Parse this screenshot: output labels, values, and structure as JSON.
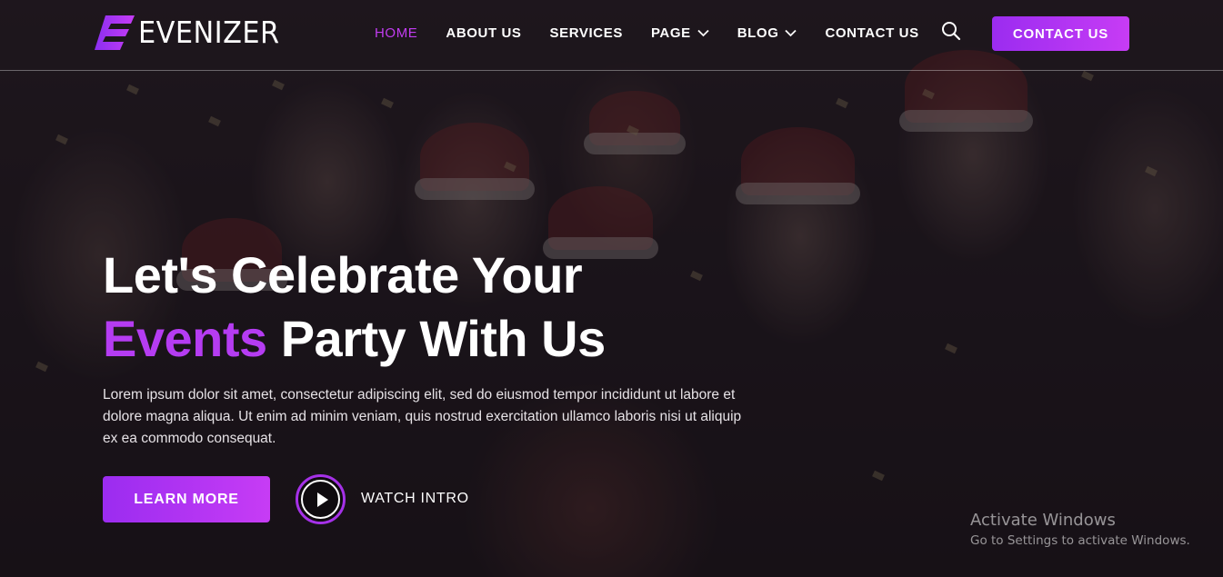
{
  "brand": {
    "name": "EVENIZER",
    "accent_color": "#b53cf2"
  },
  "nav": {
    "items": [
      {
        "label": "HOME",
        "active": true
      },
      {
        "label": "ABOUT US"
      },
      {
        "label": "SERVICES"
      },
      {
        "label": "PAGE",
        "dropdown": true
      },
      {
        "label": "BLOG",
        "dropdown": true
      },
      {
        "label": "CONTACT US"
      }
    ],
    "search_icon": "search-icon",
    "cta_label": "CONTACT US"
  },
  "hero": {
    "title_line1": "Let's Celebrate Your",
    "title_accent": "Events",
    "title_line2_rest": "Party With Us",
    "description": "Lorem ipsum dolor sit amet, consectetur adipiscing elit, sed do eiusmod tempor incididunt ut labore et dolore magna aliqua. Ut enim ad minim veniam, quis nostrud exercitation ullamco laboris nisi ut aliquip ex ea commodo consequat.",
    "primary_button": "LEARN MORE",
    "video_label": "WATCH INTRO"
  },
  "watermark": {
    "title": "Activate Windows",
    "subtitle": "Go to Settings to activate Windows."
  }
}
